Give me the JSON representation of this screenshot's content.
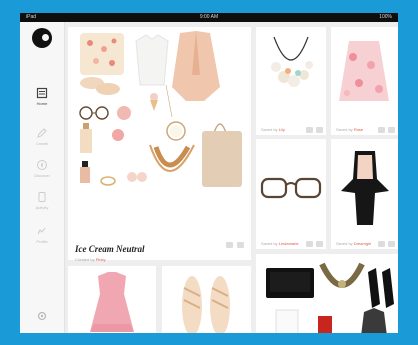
{
  "status": {
    "carrier": "iPad",
    "time": "9:00 AM",
    "battery": "100%"
  },
  "sidebar": {
    "items": [
      {
        "label": "Home",
        "icon": "home-icon"
      },
      {
        "label": "Create",
        "icon": "pencil-icon"
      },
      {
        "label": "Discover",
        "icon": "compass-icon"
      },
      {
        "label": "Activity",
        "icon": "bell-icon"
      },
      {
        "label": "Profile",
        "icon": "user-icon"
      }
    ],
    "settings_icon": "gear-icon"
  },
  "feed": {
    "featured": {
      "title": "Ice Cream Neutral",
      "credit_prefix": "Created by",
      "author": "Pinky"
    },
    "cards": [
      {
        "name": "necklace",
        "credit_prefix": "Saved by",
        "author": "Lily"
      },
      {
        "name": "floral-skirt",
        "credit_prefix": "Saved by",
        "author": "Rose"
      },
      {
        "name": "glasses",
        "credit_prefix": "Saved by",
        "author": "Lindamarie"
      },
      {
        "name": "peplum-dress",
        "credit_prefix": "Saved by",
        "author": "Dreamgirl"
      }
    ]
  },
  "colors": {
    "frame": "#1a9ad6",
    "accent": "#e05a44",
    "sidebar_bg": "#f7f7f7"
  }
}
